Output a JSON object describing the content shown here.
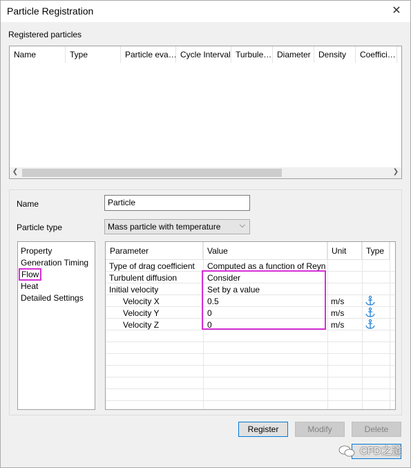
{
  "window": {
    "title": "Particle Registration"
  },
  "registered": {
    "label": "Registered particles",
    "columns": [
      "Name",
      "Type",
      "Particle eva…",
      "Cycle Interval",
      "Turbule…",
      "Diameter",
      "Density",
      "Coeffici…"
    ]
  },
  "form": {
    "name_label": "Name",
    "name_value": "Particle",
    "type_label": "Particle type",
    "type_value": "Mass particle with temperature"
  },
  "nav": {
    "items": [
      "Property",
      "Generation Timing",
      "Flow",
      "Heat",
      "Detailed Settings"
    ],
    "selected": "Flow"
  },
  "params": {
    "headers": [
      "Parameter",
      "Value",
      "Unit",
      "Type"
    ],
    "rows": [
      {
        "parameter": "Type of drag coefficient",
        "value": "Computed as a function of Reyn…",
        "unit": "",
        "type_icon": ""
      },
      {
        "parameter": "Turbulent diffusion",
        "value": "Consider",
        "unit": "",
        "type_icon": ""
      },
      {
        "parameter": "Initial velocity",
        "value": "Set by a value",
        "unit": "",
        "type_icon": ""
      },
      {
        "parameter": "Velocity X",
        "value": "0.5",
        "unit": "m/s",
        "type_icon": "anchor-icon"
      },
      {
        "parameter": "Velocity Y",
        "value": "0",
        "unit": "m/s",
        "type_icon": "anchor-icon"
      },
      {
        "parameter": "Velocity Z",
        "value": "0",
        "unit": "m/s",
        "type_icon": "anchor-icon"
      }
    ]
  },
  "buttons": {
    "register": "Register",
    "modify": "Modify",
    "delete": "Delete"
  },
  "watermark": "CFD之道",
  "colors": {
    "highlight": "#d62fd6",
    "anchor": "#1e7fd6"
  }
}
